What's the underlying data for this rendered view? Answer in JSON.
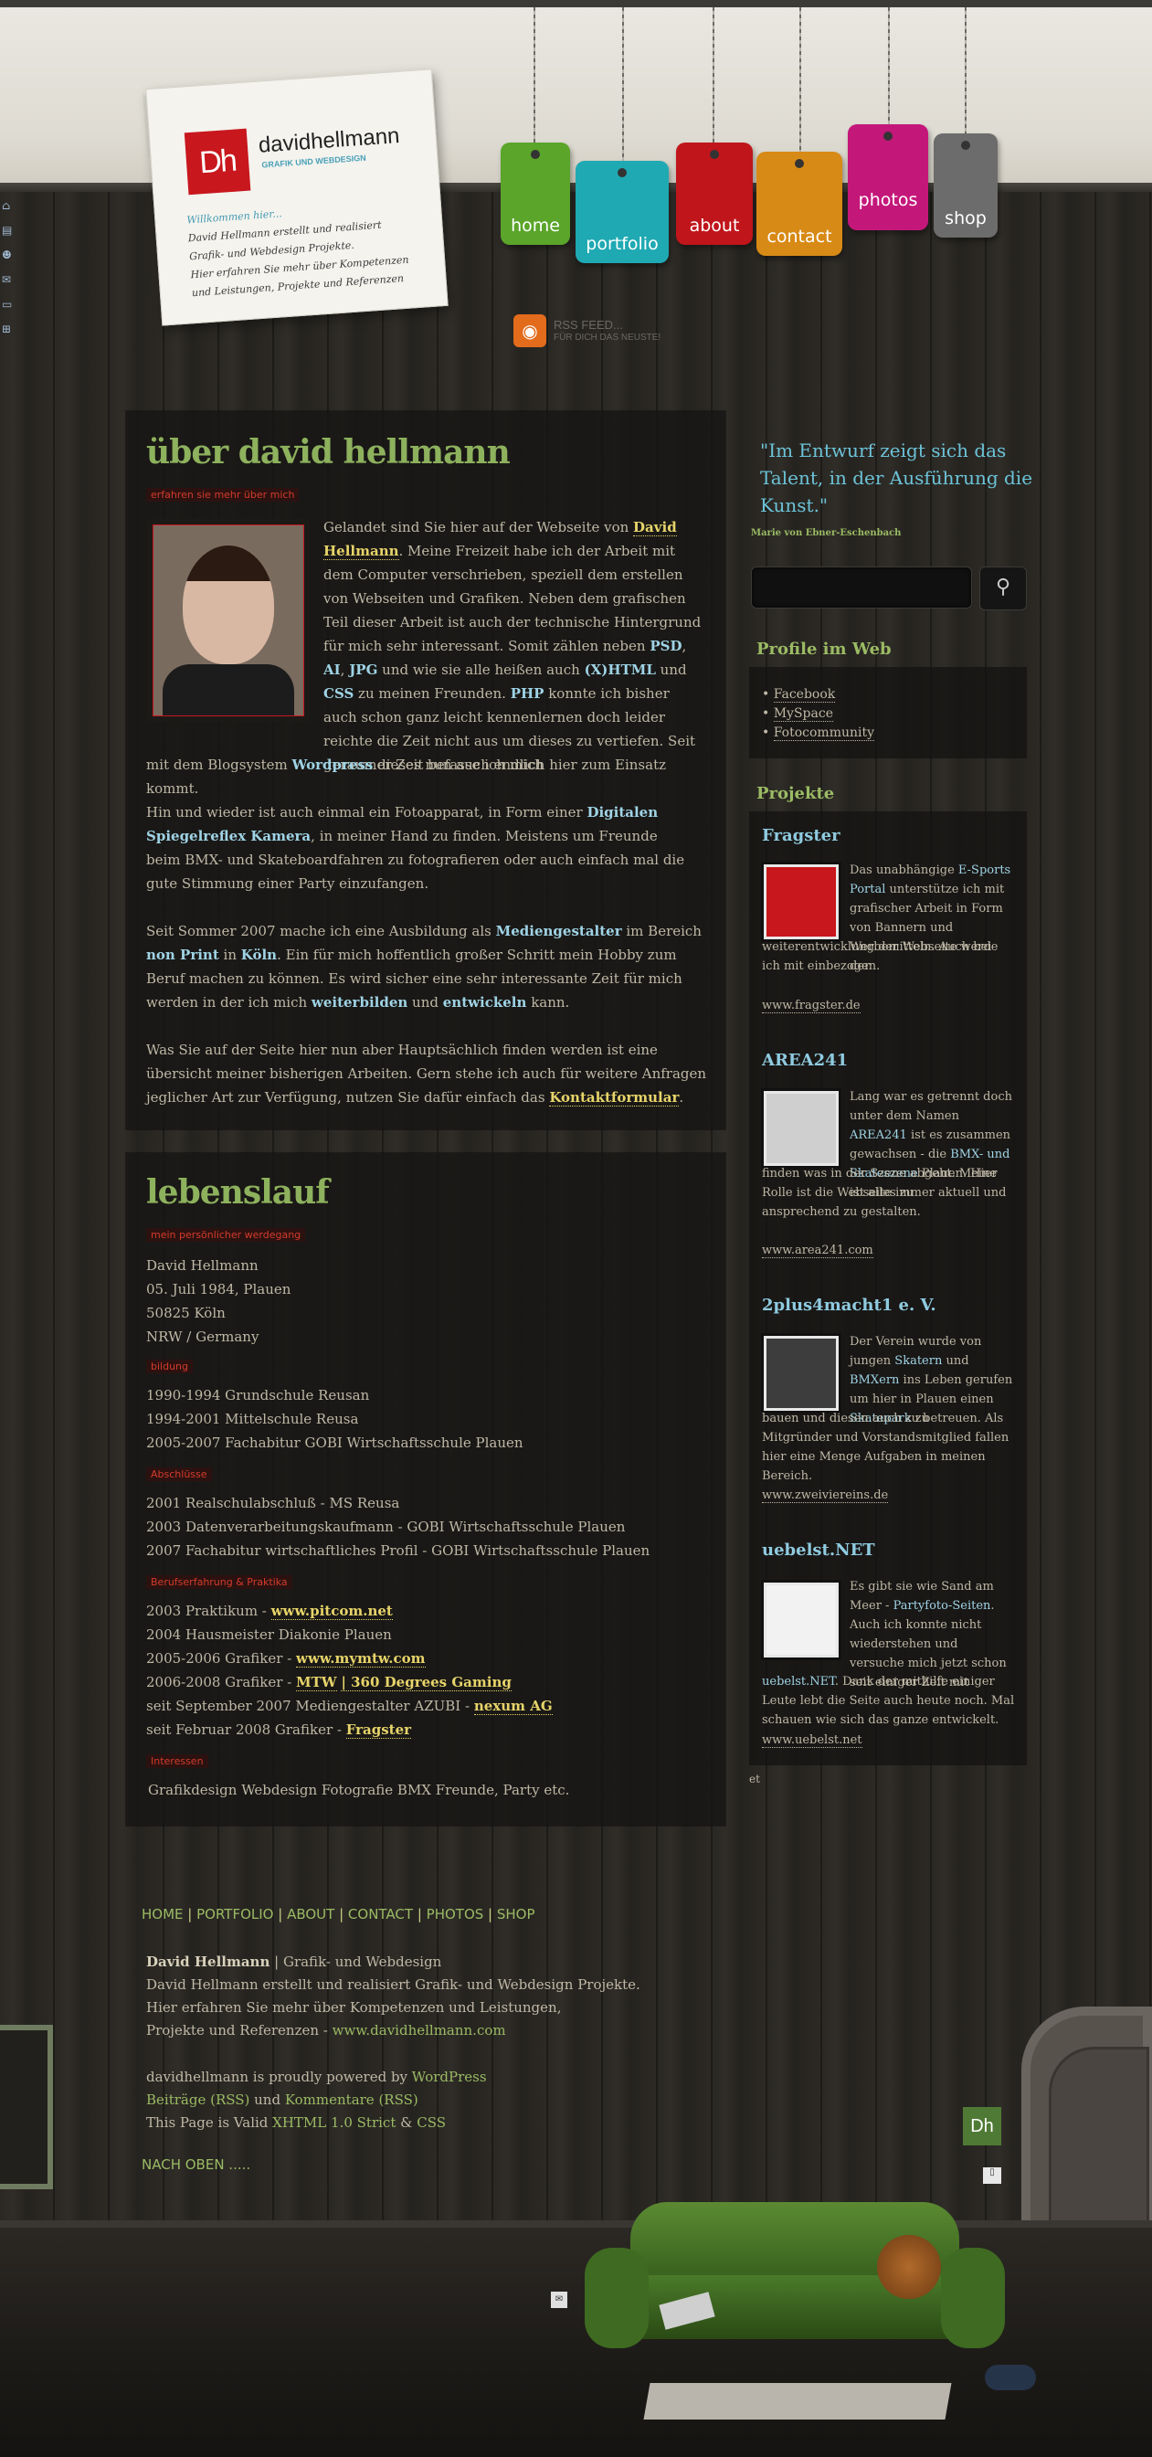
{
  "header": {
    "logo_letters": "Dh",
    "site_name": "davidhellmann",
    "site_tagline": "GRAFIK UND WEBDESIGN",
    "note_lines": [
      "Willkommen hier...",
      "David Hellmann erstellt und realisiert",
      "Grafik- und Webdesign Projekte.",
      "Hier erfahren Sie mehr über Kompetenzen",
      "und Leistungen, Projekte und Referenzen"
    ],
    "nav": [
      {
        "label": "home",
        "color": "#5aa52a"
      },
      {
        "label": "portfolio",
        "color": "#1fa9b3"
      },
      {
        "label": "about",
        "color": "#c0151b"
      },
      {
        "label": "contact",
        "color": "#d88a16"
      },
      {
        "label": "photos",
        "color": "#c4177a"
      },
      {
        "label": "shop",
        "color": "#6c6c6c"
      }
    ],
    "rss_title": "RSS FEED...",
    "rss_sub": "FÜR DICH DAS NEUSTE!"
  },
  "about": {
    "title": "über david hellmann",
    "kicker": "erfahren sie mehr über mich"
  },
  "lebenslauf": {
    "title": "lebenslauf",
    "kicker": "mein persönlicher werdegang",
    "personal": [
      "David Hellmann",
      "05. Juli 1984, Plauen",
      "50825 Köln",
      "NRW / Germany"
    ],
    "bildung_label": "bildung",
    "bildung": [
      "1990-1994 Grundschule Reusan",
      "1994-2001 Mittelschule Reusa",
      "2005-2007 Fachabitur GOBI Wirtschaftsschule Plauen"
    ],
    "abschluesse_label": "Abschlüsse",
    "abschluesse": [
      "2001 Realschulabschluß - MS Reusa",
      "2003 Datenverarbeitungskaufmann - GOBI Wirtschaftsschule Plauen",
      "2007 Fachabitur wirtschaftliches Profil - GOBI Wirtschaftsschule Plauen"
    ],
    "beruf_label": "Berufserfahrung & Praktika",
    "interessen_label": "Interessen",
    "interessen": "Grafikdesign Webdesign Fotografie BMX Freunde, Party etc."
  },
  "sidebar": {
    "quote": "\"Im Entwurf zeigt sich das Talent, in der Ausführung die Kunst.\"",
    "quote_author": "Marie von Ebner-Eschenbach",
    "search_button": "⚲",
    "profile_title": "Profile im Web",
    "profiles": [
      "Facebook",
      "MySpace",
      "Fotocommunity"
    ],
    "projects_title": "Projekte",
    "projects": [
      {
        "name": "Fragster",
        "link": "www.fragster.de"
      },
      {
        "name": "AREA241",
        "link": "www.area241.com"
      },
      {
        "name": "2plus4macht1 e. V.",
        "link": "www.zweiviereins.de"
      },
      {
        "name": "uebelst.NET",
        "link": "www.uebelst.net"
      }
    ],
    "et": "et"
  },
  "footer": {
    "nav": [
      "HOME",
      "PORTFOLIO",
      "ABOUT",
      "CONTACT",
      "PHOTOS",
      "SHOP"
    ],
    "name": "David Hellmann",
    "role": " | Grafik- und Webdesign",
    "line2": "David Hellmann erstellt und realisiert Grafik- und Webdesign Projekte.",
    "line3": "Hier erfahren Sie mehr über Kompetenzen und Leistungen,",
    "line4_prefix": "Projekte und Referenzen - ",
    "url": "www.davidhellmann.com",
    "powered_prefix": "davidhellmann is proudly powered by ",
    "powered_link": "WordPress",
    "rss_posts": "Beiträge (RSS)",
    "rss_and": " und ",
    "rss_comments": "Kommentare (RSS)",
    "valid_prefix": "This Page is Valid ",
    "valid_xhtml": "XHTML 1.0 Strict",
    "valid_and": " & ",
    "valid_css": "CSS",
    "top_link": "NACH OBEN .....",
    "dh_small": "Dh"
  }
}
